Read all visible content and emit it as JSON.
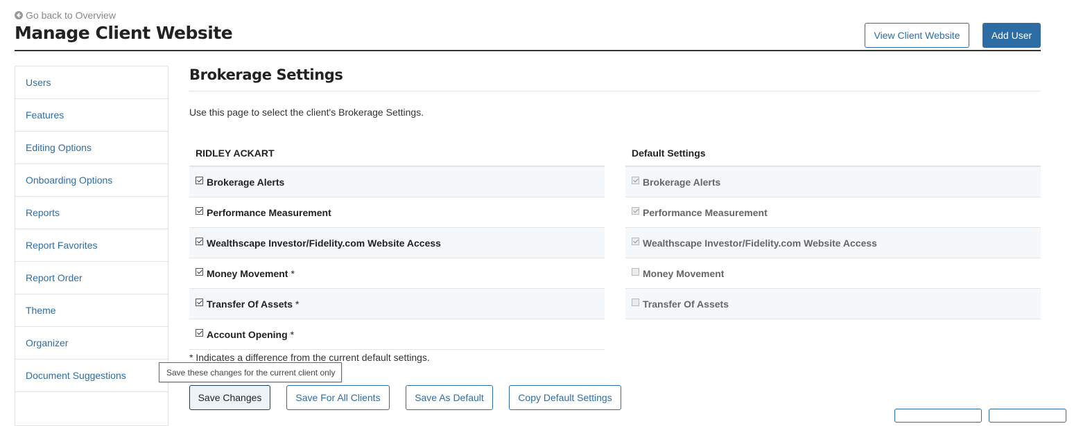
{
  "header": {
    "back_link": "Go back to Overview",
    "title": "Manage Client Website",
    "view_website_label": "View Client Website",
    "add_user_label": "Add User"
  },
  "sidebar": {
    "items": [
      {
        "label": "Users"
      },
      {
        "label": "Features"
      },
      {
        "label": "Editing Options"
      },
      {
        "label": "Onboarding Options"
      },
      {
        "label": "Reports"
      },
      {
        "label": "Report Favorites"
      },
      {
        "label": "Report Order"
      },
      {
        "label": "Theme"
      },
      {
        "label": "Organizer"
      },
      {
        "label": "Document Suggestions"
      }
    ]
  },
  "main": {
    "section_title": "Brokerage Settings",
    "intro": "Use this page to select the client's Brokerage Settings.",
    "client_column": {
      "header": "RIDLEY ACKART",
      "rows": [
        {
          "label": "Brokerage Alerts",
          "checked": true,
          "asterisk": ""
        },
        {
          "label": "Performance Measurement",
          "checked": true,
          "asterisk": ""
        },
        {
          "label": "Wealthscape Investor/Fidelity.com Website Access",
          "checked": true,
          "asterisk": ""
        },
        {
          "label": "Money Movement",
          "checked": true,
          "asterisk": "*"
        },
        {
          "label": "Transfer Of Assets",
          "checked": true,
          "asterisk": "*"
        },
        {
          "label": "Account Opening",
          "checked": true,
          "asterisk": "*"
        }
      ]
    },
    "default_column": {
      "header": "Default Settings",
      "rows": [
        {
          "label": "Brokerage Alerts",
          "checked": true
        },
        {
          "label": "Performance Measurement",
          "checked": true
        },
        {
          "label": "Wealthscape Investor/Fidelity.com Website Access",
          "checked": true
        },
        {
          "label": "Money Movement",
          "checked": false
        },
        {
          "label": "Transfer Of Assets",
          "checked": false
        }
      ]
    },
    "footnote": "* Indicates a difference from the current default settings.",
    "tooltip": "Save these changes for the current client only",
    "buttons": {
      "save_changes": "Save Changes",
      "save_all_clients": "Save For All Clients",
      "save_as_default": "Save As Default",
      "copy_default": "Copy Default Settings"
    }
  },
  "colors": {
    "accent": "#2e6da4",
    "row_stripe": "#f5f8fb",
    "border": "#e3e3e3"
  }
}
